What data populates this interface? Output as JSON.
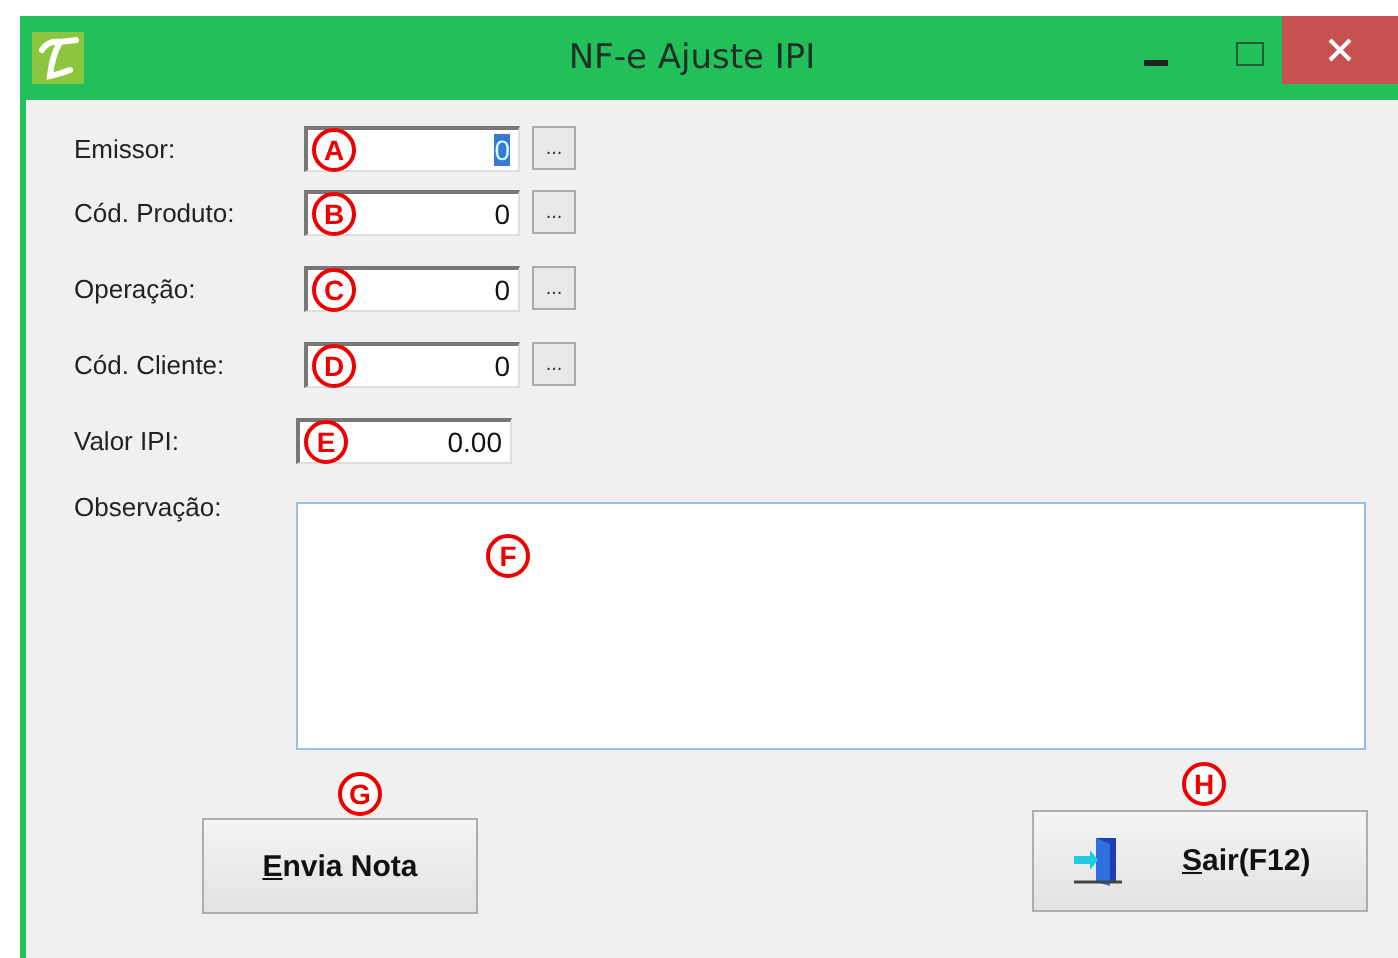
{
  "window": {
    "title": "NF-e Ajuste IPI"
  },
  "fields": [
    {
      "label": "Emissor:",
      "value": "0",
      "marker": "A",
      "lookup": true,
      "highlighted": true
    },
    {
      "label": "Cód. Produto:",
      "value": "0",
      "marker": "B",
      "lookup": true,
      "highlighted": false
    },
    {
      "label": "Operação:",
      "value": "0",
      "marker": "C",
      "lookup": true,
      "highlighted": false
    },
    {
      "label": "Cód. Cliente:",
      "value": "0",
      "marker": "D",
      "lookup": true,
      "highlighted": false
    },
    {
      "label": "Valor IPI:",
      "value": "0.00",
      "marker": "E",
      "lookup": false,
      "highlighted": false
    }
  ],
  "lookup_label": "...",
  "notes": {
    "label": "Observação:",
    "marker": "F"
  },
  "buttons": [
    {
      "label": "Envia Nota",
      "marker": "G",
      "kind": "send"
    },
    {
      "label": "Sair(F12)",
      "marker": "H",
      "kind": "exit"
    }
  ]
}
